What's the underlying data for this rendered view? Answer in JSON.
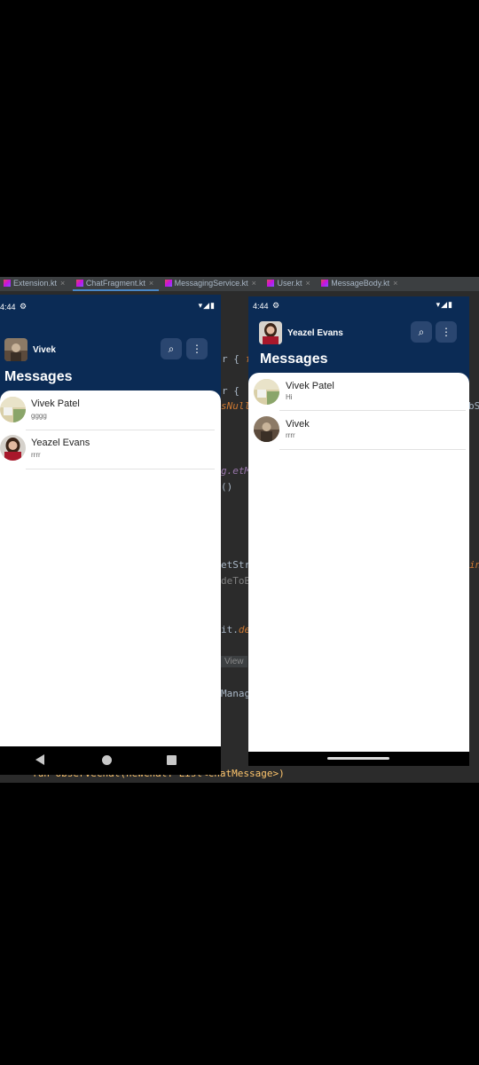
{
  "ide": {
    "tabs": [
      {
        "label": "Extension.kt",
        "x": "×"
      },
      {
        "label": "ChatFragment.kt",
        "x": "×"
      },
      {
        "label": "MessagingService.kt",
        "x": "×"
      },
      {
        "label": "User.kt",
        "x": "×"
      },
      {
        "label": "MessageBody.kt",
        "x": "×"
      }
    ],
    "code": {
      "l1a": "r { ",
      "l1b": "f",
      "l2": "r {",
      "l3a": "sNull",
      "l3b": "bS",
      "l4": "g.etM",
      "l5": "()",
      "l6a": "etStr",
      "l6b": "in",
      "l7": "deToB",
      "l8a": "it.",
      "l8b": "de",
      "chip": "View",
      "l9": "Manag",
      "bottom": "fun observeChat(newChat: List<ChatMessage>)"
    }
  },
  "left_phone": {
    "status": {
      "time": "4:44",
      "gear": "⚙",
      "icons": "▾◢▮"
    },
    "toolbar": {
      "title": "Vivek",
      "search_icon": "⌕",
      "more_icon": "⋮"
    },
    "section_title": "Messages",
    "chats": [
      {
        "name": "Vivek Patel",
        "message": "gggg"
      },
      {
        "name": "Yeazel Evans",
        "message": "rrrr"
      }
    ]
  },
  "right_phone": {
    "status": {
      "time": "4:44",
      "gear": "⚙",
      "icons": "▾◢▮"
    },
    "toolbar": {
      "title": "Yeazel Evans",
      "search_icon": "⌕",
      "more_icon": "⋮"
    },
    "section_title": "Messages",
    "chats": [
      {
        "name": "Vivek Patel",
        "message": "Hi"
      },
      {
        "name": "Vivek",
        "message": "rrrr"
      }
    ]
  }
}
